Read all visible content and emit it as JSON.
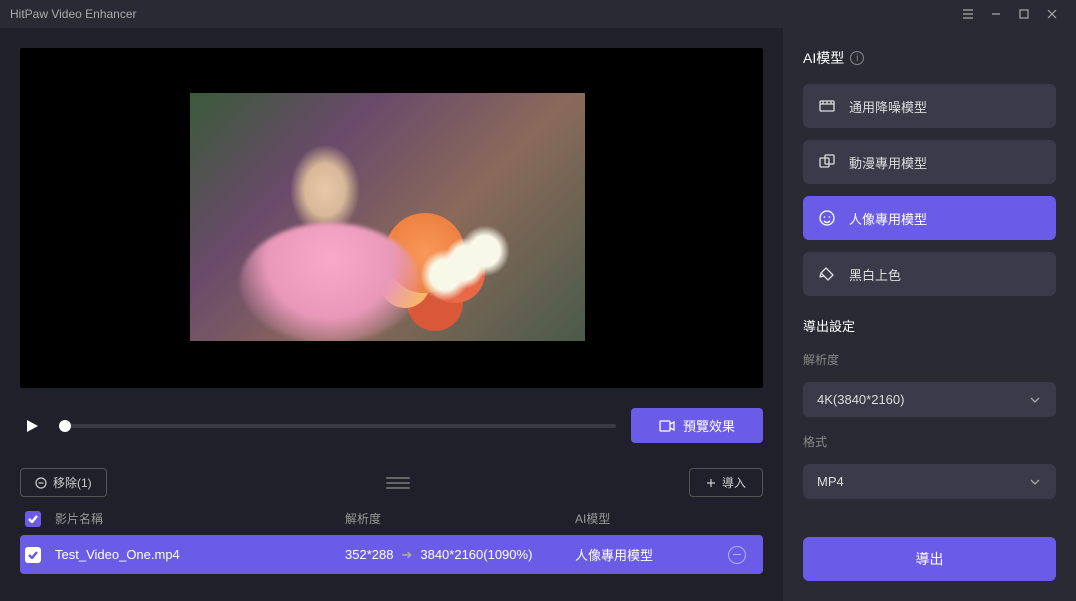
{
  "window": {
    "title": "HitPaw Video Enhancer"
  },
  "preview": {
    "button_label": "預覽效果"
  },
  "list": {
    "remove_label": "移除(1)",
    "import_label": "導入",
    "headers": {
      "name": "影片名稱",
      "resolution": "解析度",
      "model": "AI模型"
    },
    "rows": [
      {
        "name": "Test_Video_One.mp4",
        "src_res": "352*288",
        "dst_res": "3840*2160(1090%)",
        "model": "人像專用模型"
      }
    ]
  },
  "sidebar": {
    "ai_models_title": "AI模型",
    "models": [
      {
        "label": "通用降噪模型"
      },
      {
        "label": "動漫專用模型"
      },
      {
        "label": "人像專用模型"
      },
      {
        "label": "黑白上色"
      }
    ],
    "export_settings_label": "導出設定",
    "resolution_label": "解析度",
    "resolution_value": "4K(3840*2160)",
    "format_label": "格式",
    "format_value": "MP4",
    "export_button": "導出"
  }
}
